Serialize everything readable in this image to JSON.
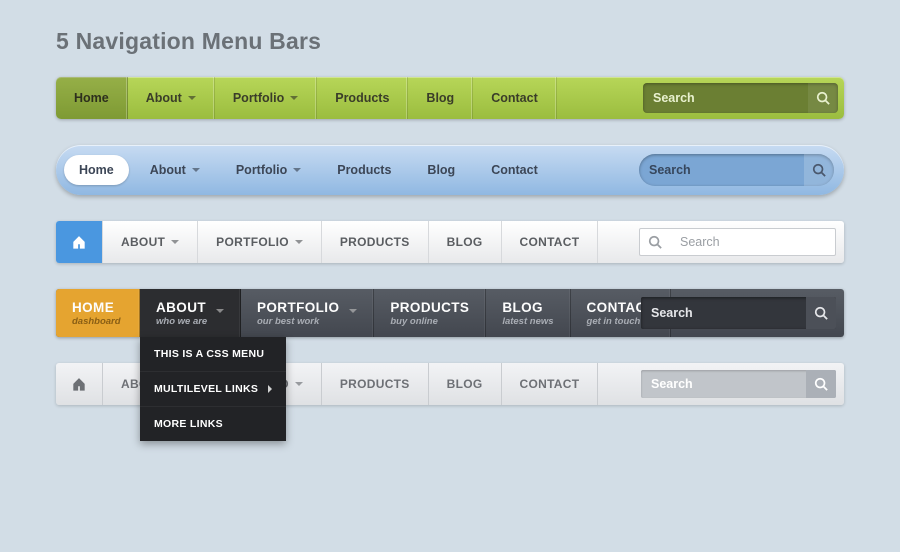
{
  "title": "5 Navigation Menu Bars",
  "nav_items": [
    "Home",
    "About",
    "Portfolio",
    "Products",
    "Blog",
    "Contact"
  ],
  "nav_items_upper": [
    "ABOUT",
    "PORTFOLIO",
    "PRODUCTS",
    "BLOG",
    "CONTACT"
  ],
  "nav4": {
    "items": [
      {
        "label": "HOME",
        "sub": "dashboard",
        "caret": false
      },
      {
        "label": "ABOUT",
        "sub": "who we are",
        "caret": true
      },
      {
        "label": "PORTFOLIO",
        "sub": "our best work",
        "caret": true
      },
      {
        "label": "PRODUCTS",
        "sub": "buy online",
        "caret": false
      },
      {
        "label": "BLOG",
        "sub": "latest news",
        "caret": false
      },
      {
        "label": "CONTACT",
        "sub": "get in touch",
        "caret": false
      }
    ],
    "dropdown": [
      "THIS IS A CSS MENU",
      "MULTILEVEL LINKS",
      "MORE LINKS"
    ]
  },
  "search_placeholder": "Search",
  "colors": {
    "green": "#a8c948",
    "blue_pill": "#9bc0e6",
    "blue_home": "#4a97e0",
    "orange": "#e5a430",
    "dark": "#4b4f57"
  }
}
